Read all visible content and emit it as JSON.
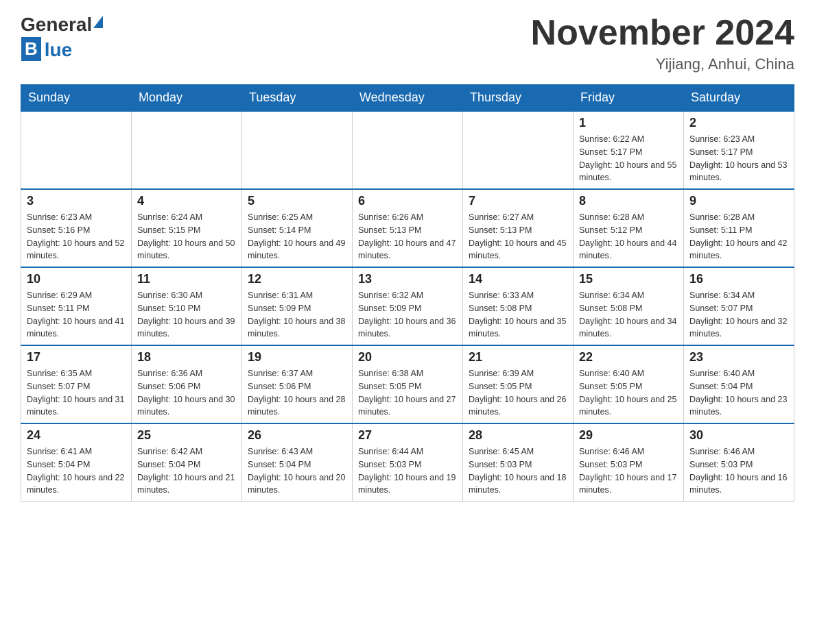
{
  "logo": {
    "general": "General",
    "blue": "Blue"
  },
  "title": "November 2024",
  "subtitle": "Yijiang, Anhui, China",
  "weekdays": [
    "Sunday",
    "Monday",
    "Tuesday",
    "Wednesday",
    "Thursday",
    "Friday",
    "Saturday"
  ],
  "weeks": [
    [
      {
        "day": "",
        "info": ""
      },
      {
        "day": "",
        "info": ""
      },
      {
        "day": "",
        "info": ""
      },
      {
        "day": "",
        "info": ""
      },
      {
        "day": "",
        "info": ""
      },
      {
        "day": "1",
        "info": "Sunrise: 6:22 AM\nSunset: 5:17 PM\nDaylight: 10 hours and 55 minutes."
      },
      {
        "day": "2",
        "info": "Sunrise: 6:23 AM\nSunset: 5:17 PM\nDaylight: 10 hours and 53 minutes."
      }
    ],
    [
      {
        "day": "3",
        "info": "Sunrise: 6:23 AM\nSunset: 5:16 PM\nDaylight: 10 hours and 52 minutes."
      },
      {
        "day": "4",
        "info": "Sunrise: 6:24 AM\nSunset: 5:15 PM\nDaylight: 10 hours and 50 minutes."
      },
      {
        "day": "5",
        "info": "Sunrise: 6:25 AM\nSunset: 5:14 PM\nDaylight: 10 hours and 49 minutes."
      },
      {
        "day": "6",
        "info": "Sunrise: 6:26 AM\nSunset: 5:13 PM\nDaylight: 10 hours and 47 minutes."
      },
      {
        "day": "7",
        "info": "Sunrise: 6:27 AM\nSunset: 5:13 PM\nDaylight: 10 hours and 45 minutes."
      },
      {
        "day": "8",
        "info": "Sunrise: 6:28 AM\nSunset: 5:12 PM\nDaylight: 10 hours and 44 minutes."
      },
      {
        "day": "9",
        "info": "Sunrise: 6:28 AM\nSunset: 5:11 PM\nDaylight: 10 hours and 42 minutes."
      }
    ],
    [
      {
        "day": "10",
        "info": "Sunrise: 6:29 AM\nSunset: 5:11 PM\nDaylight: 10 hours and 41 minutes."
      },
      {
        "day": "11",
        "info": "Sunrise: 6:30 AM\nSunset: 5:10 PM\nDaylight: 10 hours and 39 minutes."
      },
      {
        "day": "12",
        "info": "Sunrise: 6:31 AM\nSunset: 5:09 PM\nDaylight: 10 hours and 38 minutes."
      },
      {
        "day": "13",
        "info": "Sunrise: 6:32 AM\nSunset: 5:09 PM\nDaylight: 10 hours and 36 minutes."
      },
      {
        "day": "14",
        "info": "Sunrise: 6:33 AM\nSunset: 5:08 PM\nDaylight: 10 hours and 35 minutes."
      },
      {
        "day": "15",
        "info": "Sunrise: 6:34 AM\nSunset: 5:08 PM\nDaylight: 10 hours and 34 minutes."
      },
      {
        "day": "16",
        "info": "Sunrise: 6:34 AM\nSunset: 5:07 PM\nDaylight: 10 hours and 32 minutes."
      }
    ],
    [
      {
        "day": "17",
        "info": "Sunrise: 6:35 AM\nSunset: 5:07 PM\nDaylight: 10 hours and 31 minutes."
      },
      {
        "day": "18",
        "info": "Sunrise: 6:36 AM\nSunset: 5:06 PM\nDaylight: 10 hours and 30 minutes."
      },
      {
        "day": "19",
        "info": "Sunrise: 6:37 AM\nSunset: 5:06 PM\nDaylight: 10 hours and 28 minutes."
      },
      {
        "day": "20",
        "info": "Sunrise: 6:38 AM\nSunset: 5:05 PM\nDaylight: 10 hours and 27 minutes."
      },
      {
        "day": "21",
        "info": "Sunrise: 6:39 AM\nSunset: 5:05 PM\nDaylight: 10 hours and 26 minutes."
      },
      {
        "day": "22",
        "info": "Sunrise: 6:40 AM\nSunset: 5:05 PM\nDaylight: 10 hours and 25 minutes."
      },
      {
        "day": "23",
        "info": "Sunrise: 6:40 AM\nSunset: 5:04 PM\nDaylight: 10 hours and 23 minutes."
      }
    ],
    [
      {
        "day": "24",
        "info": "Sunrise: 6:41 AM\nSunset: 5:04 PM\nDaylight: 10 hours and 22 minutes."
      },
      {
        "day": "25",
        "info": "Sunrise: 6:42 AM\nSunset: 5:04 PM\nDaylight: 10 hours and 21 minutes."
      },
      {
        "day": "26",
        "info": "Sunrise: 6:43 AM\nSunset: 5:04 PM\nDaylight: 10 hours and 20 minutes."
      },
      {
        "day": "27",
        "info": "Sunrise: 6:44 AM\nSunset: 5:03 PM\nDaylight: 10 hours and 19 minutes."
      },
      {
        "day": "28",
        "info": "Sunrise: 6:45 AM\nSunset: 5:03 PM\nDaylight: 10 hours and 18 minutes."
      },
      {
        "day": "29",
        "info": "Sunrise: 6:46 AM\nSunset: 5:03 PM\nDaylight: 10 hours and 17 minutes."
      },
      {
        "day": "30",
        "info": "Sunrise: 6:46 AM\nSunset: 5:03 PM\nDaylight: 10 hours and 16 minutes."
      }
    ]
  ]
}
